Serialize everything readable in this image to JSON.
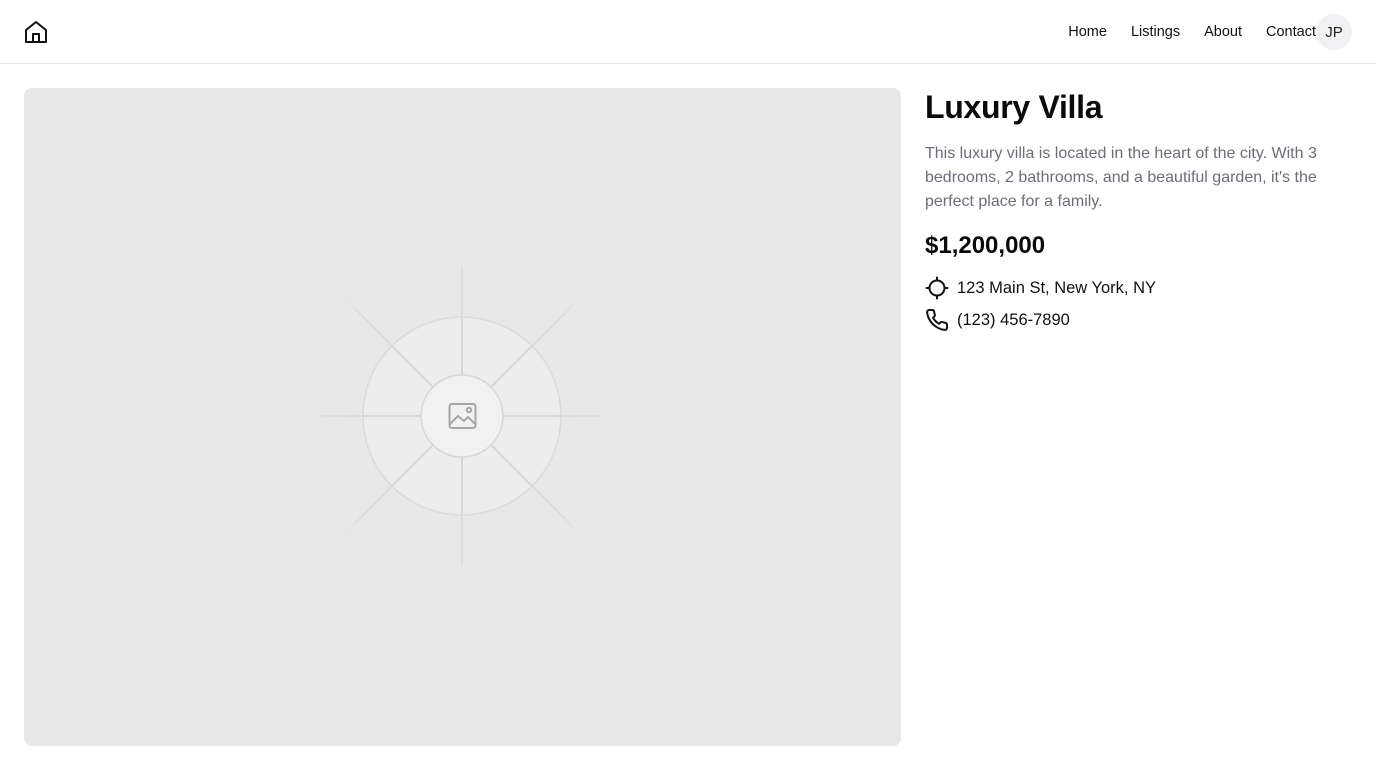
{
  "header": {
    "logo_icon": "home-icon",
    "nav": [
      {
        "label": "Home"
      },
      {
        "label": "Listings"
      },
      {
        "label": "About"
      },
      {
        "label": "Contact"
      }
    ],
    "avatar_initials": "JP"
  },
  "listing": {
    "image_icon": "image-placeholder-icon",
    "title": "Luxury Villa",
    "description": "This luxury villa is located in the heart of the city. With 3 bedrooms, 2 bathrooms, and a beautiful garden, it's the perfect place for a family.",
    "price": "$1,200,000",
    "address_icon": "crosshair-location-icon",
    "address": "123 Main St, New York, NY",
    "phone_icon": "phone-icon",
    "phone": "(123) 456-7890"
  }
}
